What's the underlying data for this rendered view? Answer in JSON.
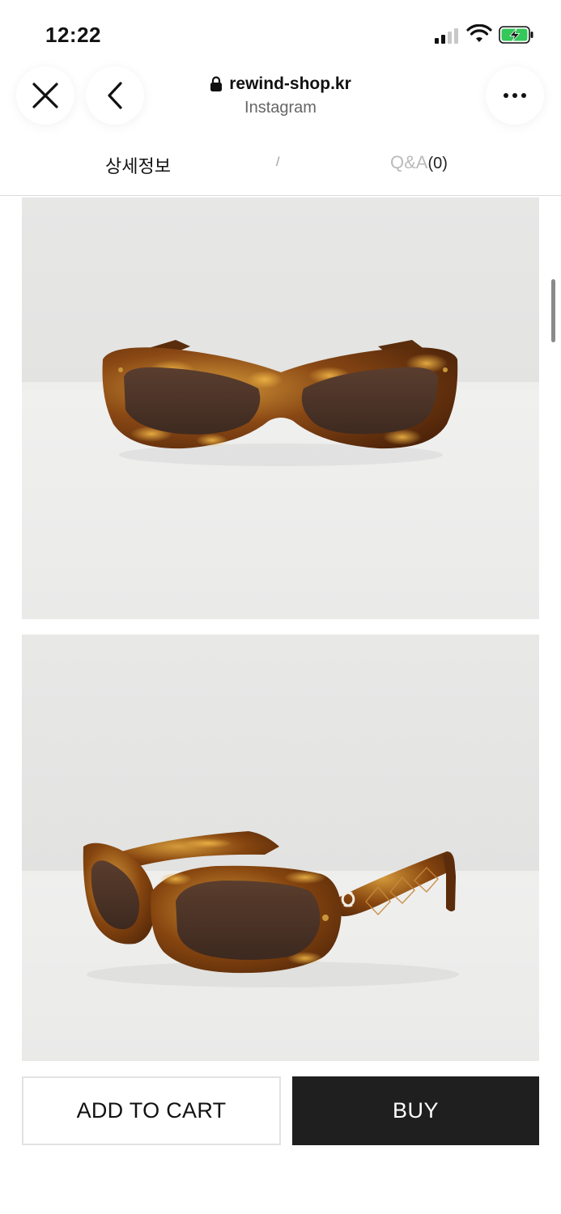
{
  "status_bar": {
    "time": "12:22",
    "icons": [
      "cellular-signal-icon",
      "wifi-icon",
      "battery-charging-icon"
    ],
    "battery_color": "#34c759"
  },
  "browser": {
    "url": "rewind-shop.kr",
    "source": "Instagram",
    "icons": [
      "close-icon",
      "back-arrow-icon",
      "lock-icon",
      "more-icon"
    ]
  },
  "tabs": {
    "detail": "상세정보",
    "separator": "/",
    "qa_label": "Q&A",
    "qa_count": "(0)"
  },
  "photos": [
    {
      "name": "product-photo-front",
      "subject": "tortoiseshell sunglasses, front view"
    },
    {
      "name": "product-photo-side",
      "subject": "tortoiseshell sunglasses, angled side view"
    }
  ],
  "actions": {
    "add_to_cart": "ADD TO CART",
    "buy": "BUY"
  },
  "colors": {
    "buy_button": "#1f1f1f",
    "tortoise_dark": "#5a2d0c",
    "tortoise_light": "#c98a2b",
    "lens": "#4e3528"
  }
}
